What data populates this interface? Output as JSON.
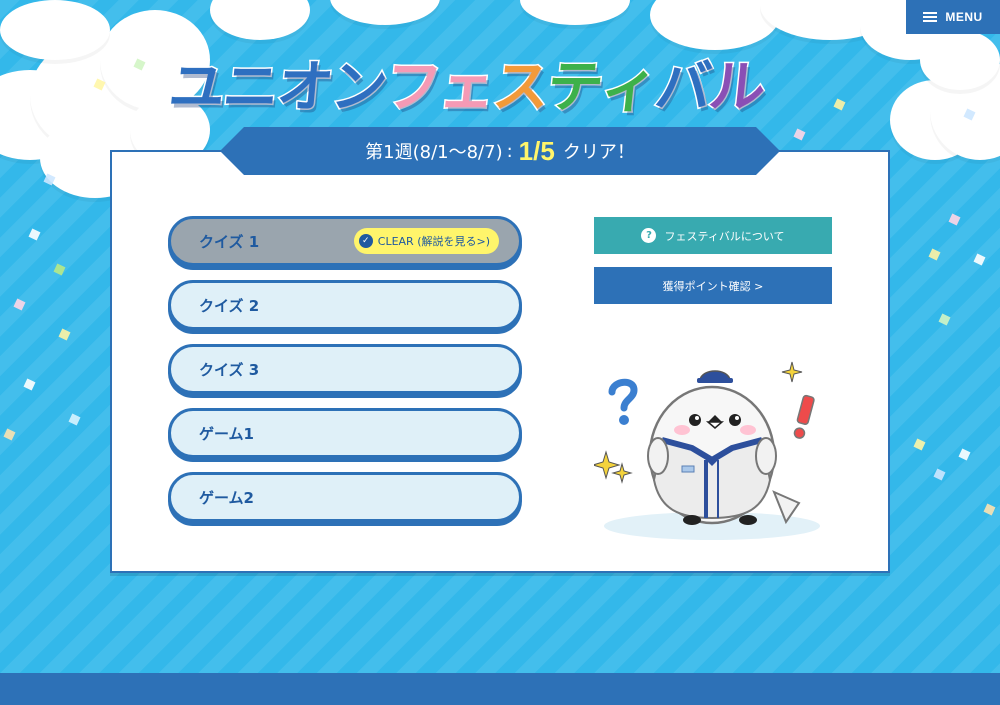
{
  "header": {
    "menu_label": "MENU",
    "menu_icon": "hamburger-icon"
  },
  "logo": {
    "chars": [
      {
        "ch": "ユ",
        "color": "#2e6fc0"
      },
      {
        "ch": "ニ",
        "color": "#2e6fc0"
      },
      {
        "ch": "オ",
        "color": "#2e6fc0"
      },
      {
        "ch": "ン",
        "color": "#2e6fc0"
      },
      {
        "ch": "フ",
        "color": "#f59ab5"
      },
      {
        "ch": "ェ",
        "color": "#f59ab5"
      },
      {
        "ch": "ス",
        "color": "#f29a3a"
      },
      {
        "ch": "テ",
        "color": "#3db14a"
      },
      {
        "ch": "ィ",
        "color": "#3db14a"
      },
      {
        "ch": "バ",
        "color": "#2e6fc0"
      },
      {
        "ch": "ル",
        "color": "#8a4fb5"
      }
    ]
  },
  "week": {
    "label": "第1週(8/1〜8/7)",
    "separator": ":",
    "progress": "1/5",
    "suffix": "クリア！"
  },
  "quizzes": [
    {
      "label": "クイズ 1",
      "cleared": true,
      "badge": "CLEAR (解説を見る>)"
    },
    {
      "label": "クイズ 2",
      "cleared": false
    },
    {
      "label": "クイズ 3",
      "cleared": false
    },
    {
      "label": "ゲーム1",
      "cleared": false
    },
    {
      "label": "ゲーム2",
      "cleared": false
    }
  ],
  "side_buttons": {
    "about_label": "フェスティバルについて",
    "points_label": "獲得ポイント確認 >"
  },
  "colors": {
    "brand_blue": "#2d71b7",
    "teal": "#38aab0",
    "highlight_yellow": "#fff56b",
    "background_sky": "#33b8ea"
  }
}
